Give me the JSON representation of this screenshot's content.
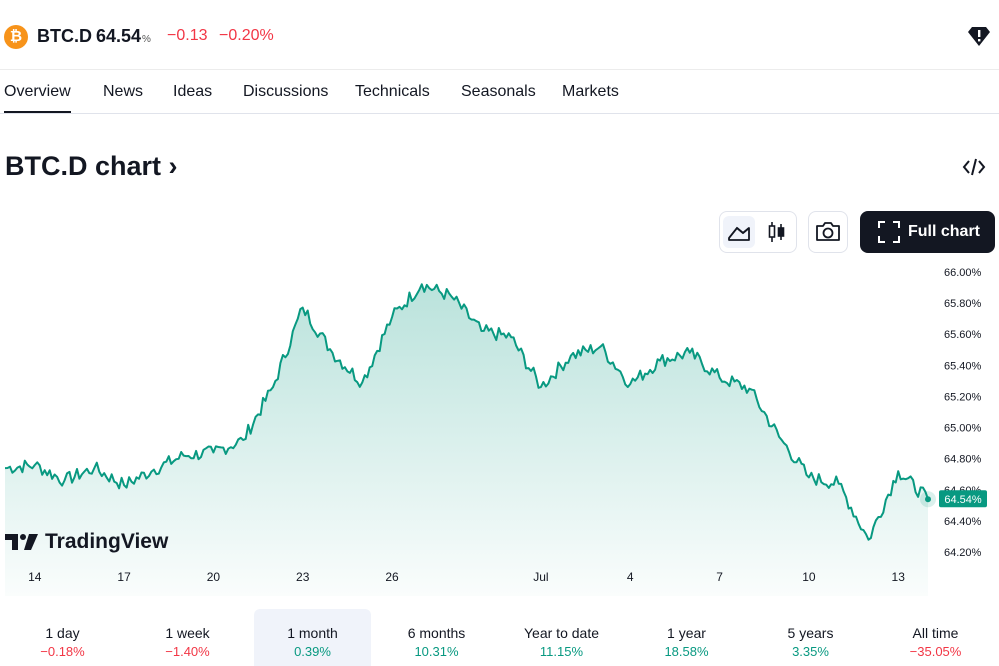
{
  "header": {
    "coin_glyph": "₿",
    "symbol": "BTC.D",
    "price": "64.54",
    "price_unit": "%",
    "change": "−0.13",
    "change_percent": "−0.20%",
    "alert_icon": "shield-alert-icon"
  },
  "tabs": [
    {
      "label": "Overview",
      "active": true
    },
    {
      "label": "News"
    },
    {
      "label": "Ideas"
    },
    {
      "label": "Discussions"
    },
    {
      "label": "Technicals"
    },
    {
      "label": "Seasonals"
    },
    {
      "label": "Markets"
    }
  ],
  "title": "BTC.D chart ›",
  "toolbar": {
    "full_chart_label": "Full chart",
    "icons": [
      "area-chart-icon",
      "candles-icon",
      "camera-icon",
      "fullscreen-icon",
      "embed-code-icon"
    ]
  },
  "branding": {
    "logo_text": "TradingView"
  },
  "colors": {
    "accent": "#089981",
    "negative": "#f23645",
    "text": "#131722",
    "button_dark": "#131722"
  },
  "chart_data": {
    "type": "area",
    "x_tick_labels": [
      "14",
      "17",
      "20",
      "23",
      "26",
      "Jul",
      "4",
      "7",
      "10",
      "13"
    ],
    "y_tick_labels": [
      "66.00%",
      "65.80%",
      "65.60%",
      "65.40%",
      "65.20%",
      "65.00%",
      "64.80%",
      "64.60%",
      "64.40%",
      "64.20%"
    ],
    "ylim": [
      64.15,
      66.05
    ],
    "last_value_label": "64.54%",
    "x": [
      "Jun 13",
      "Jun 14",
      "Jun 15",
      "Jun 16",
      "Jun 17",
      "Jun 18",
      "Jun 19",
      "Jun 20",
      "Jun 21",
      "Jun 22",
      "Jun 23",
      "Jun 24",
      "Jun 25",
      "Jun 26",
      "Jun 27",
      "Jun 28",
      "Jun 29",
      "Jun 30",
      "Jul 1",
      "Jul 2",
      "Jul 3",
      "Jul 4",
      "Jul 5",
      "Jul 6",
      "Jul 7",
      "Jul 8",
      "Jul 9",
      "Jul 10",
      "Jul 11",
      "Jul 12",
      "Jul 13",
      "Jul 14"
    ],
    "series": [
      {
        "values": [
          64.74,
          64.76,
          64.66,
          64.74,
          64.63,
          64.73,
          64.82,
          64.84,
          64.92,
          65.26,
          65.77,
          65.48,
          65.29,
          65.71,
          65.92,
          65.84,
          65.62,
          65.58,
          65.26,
          65.46,
          65.52,
          65.28,
          65.43,
          65.48,
          65.32,
          65.25,
          64.94,
          64.68,
          64.64,
          64.28,
          64.72,
          64.54
        ]
      }
    ],
    "grid": false,
    "y_axis_position": "right"
  },
  "periods": [
    {
      "label": "1 day",
      "value": "−0.18%",
      "positive": false
    },
    {
      "label": "1 week",
      "value": "−1.40%",
      "positive": false
    },
    {
      "label": "1 month",
      "value": "0.39%",
      "positive": true,
      "selected": true
    },
    {
      "label": "6 months",
      "value": "10.31%",
      "positive": true
    },
    {
      "label": "Year to date",
      "value": "11.15%",
      "positive": true
    },
    {
      "label": "1 year",
      "value": "18.58%",
      "positive": true
    },
    {
      "label": "5 years",
      "value": "3.35%",
      "positive": true
    },
    {
      "label": "All time",
      "value": "−35.05%",
      "positive": false
    }
  ]
}
